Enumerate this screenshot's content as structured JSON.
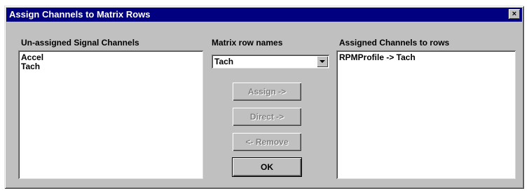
{
  "dialog": {
    "title": "Assign Channels to Matrix Rows",
    "close_glyph": "×"
  },
  "unassigned": {
    "label": "Un-assigned Signal Channels",
    "items": [
      "Accel",
      "Tach"
    ]
  },
  "matrix_row": {
    "label": "Matrix row names",
    "selected": "Tach"
  },
  "assigned": {
    "label": "Assigned Channels to rows",
    "items": [
      "RPMProfile -> Tach"
    ]
  },
  "buttons": {
    "assign": "Assign ->",
    "direct": "Direct ->",
    "remove": "<- Remove",
    "ok": "OK"
  }
}
